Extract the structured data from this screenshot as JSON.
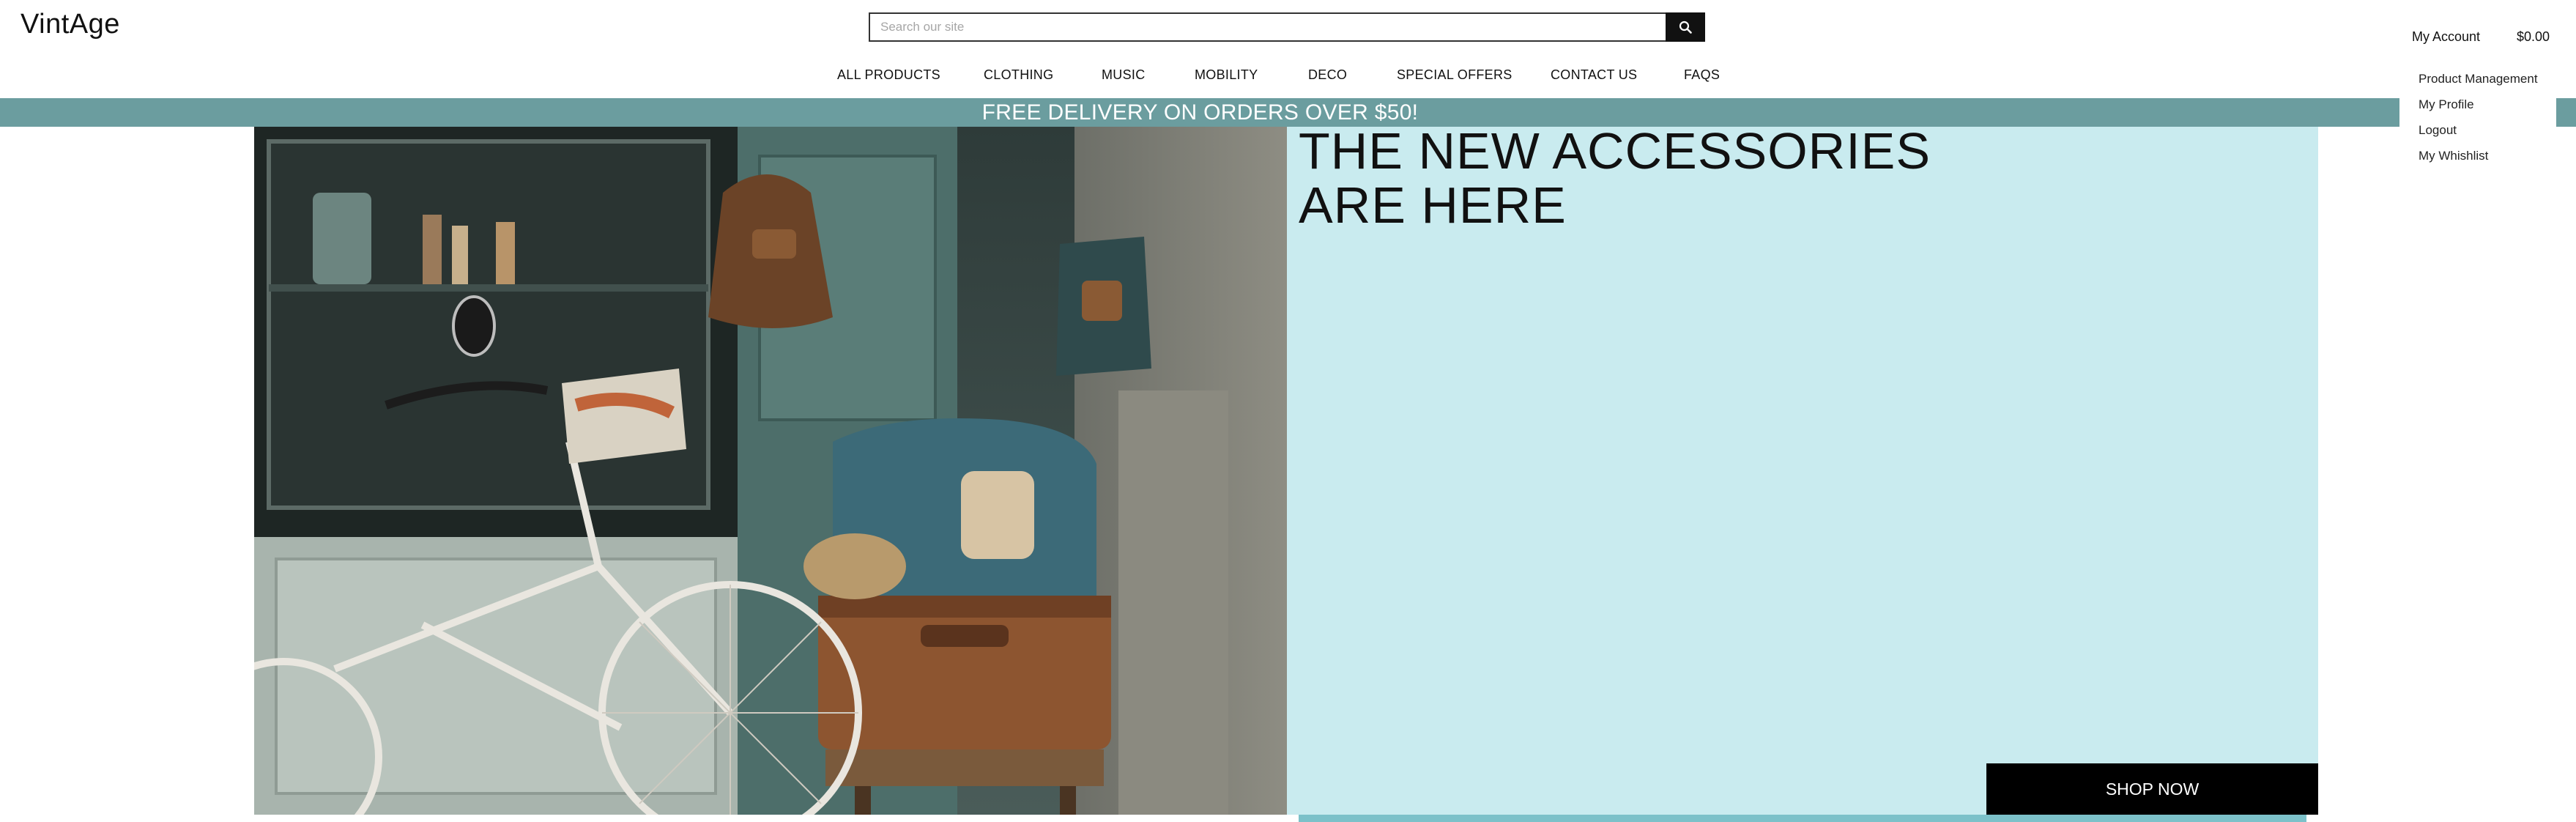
{
  "header": {
    "logo": "VintAge",
    "search": {
      "placeholder": "Search our site",
      "value": "",
      "icon": "search-icon"
    },
    "account_label": "My Account",
    "cart_total": "$0.00"
  },
  "account_menu": {
    "items": [
      {
        "label": "Product Management"
      },
      {
        "label": "My Profile"
      },
      {
        "label": "Logout"
      },
      {
        "label": "My Whishlist"
      }
    ]
  },
  "nav": {
    "items": [
      {
        "label": "ALL PRODUCTS"
      },
      {
        "label": "CLOTHING"
      },
      {
        "label": "MUSIC"
      },
      {
        "label": "MOBILITY"
      },
      {
        "label": "DECO"
      },
      {
        "label": "SPECIAL OFFERS"
      },
      {
        "label": "CONTACT US"
      },
      {
        "label": "FAQS"
      }
    ]
  },
  "promo": {
    "text": "FREE DELIVERY ON ORDERS OVER $50!"
  },
  "hero": {
    "title": "THE NEW ACCESSORIES ARE HERE",
    "cta_label": "SHOP NOW"
  },
  "colors": {
    "promo_bar": "#6b9d9f",
    "hero_panel": "#c9ebef",
    "cta_background": "#000000",
    "accent_strip": "#7cc1c9"
  }
}
